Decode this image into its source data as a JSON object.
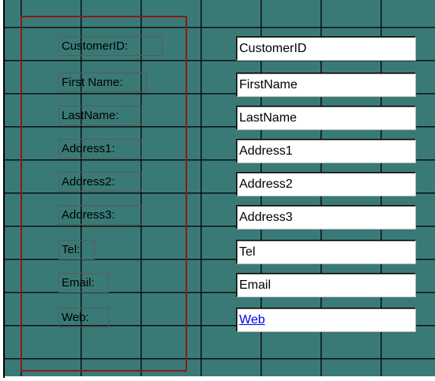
{
  "form": {
    "rows": [
      {
        "label": "CustomerID:",
        "field": "CustomerID"
      },
      {
        "label": "First Name:",
        "field": "FirstName"
      },
      {
        "label": "LastName:",
        "field": "LastName"
      },
      {
        "label": "Address1:",
        "field": "Address1"
      },
      {
        "label": "Address2:",
        "field": "Address2"
      },
      {
        "label": "Address3:",
        "field": "Address3"
      },
      {
        "label": "Tel:",
        "field": "Tel"
      },
      {
        "label": "Email:",
        "field": "Email"
      },
      {
        "label": "Web:",
        "field": "Web"
      }
    ]
  },
  "colors": {
    "background": "#3a7a76",
    "grid": "#000000",
    "selection": "#8a1a1a",
    "link": "#0000ee"
  }
}
